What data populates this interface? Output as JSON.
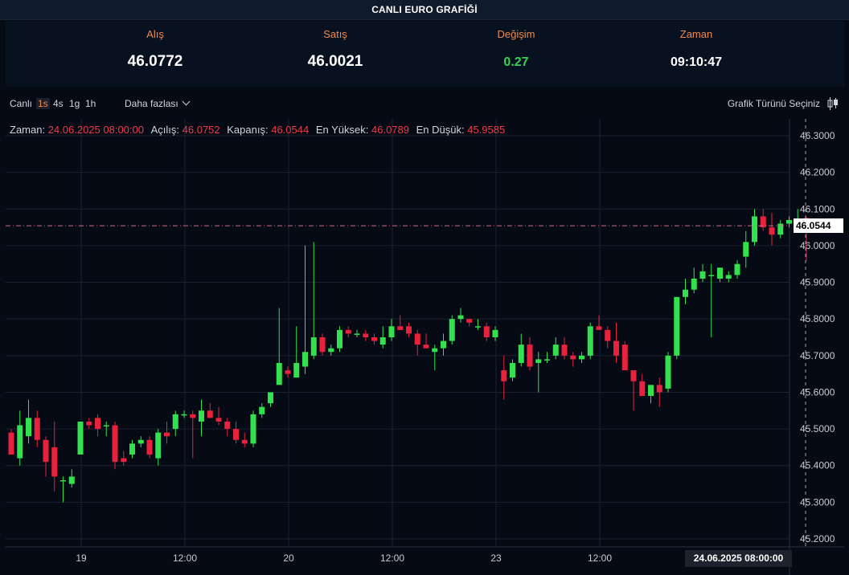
{
  "header": {
    "title": "CANLI EURO GRAFİĞİ"
  },
  "quote": {
    "buy_label": "Alış",
    "buy_value": "46.0772",
    "sell_label": "Satış",
    "sell_value": "46.0021",
    "change_label": "Değişim",
    "change_value": "0.27",
    "time_label": "Zaman",
    "time_value": "09:10:47"
  },
  "toolbar": {
    "live_label": "Canlı",
    "timeframes": [
      "1s",
      "4s",
      "1g",
      "1h"
    ],
    "active_timeframe": "1s",
    "more_label": "Daha fazlası",
    "chart_type_label": "Grafik Türünü Seçiniz"
  },
  "ohlc": {
    "time_label": "Zaman:",
    "time_value": "24.06.2025 08:00:00",
    "open_label": "Açılış:",
    "open_value": "46.0752",
    "close_label": "Kapanış:",
    "close_value": "46.0544",
    "high_label": "En Yüksek:",
    "high_value": "46.0789",
    "low_label": "En Düşük:",
    "low_value": "45.9585"
  },
  "crosshair": {
    "price_label": "46.0544",
    "time_label": "24.06.2025   08:00:00"
  },
  "colors": {
    "up": "#33e04d",
    "down": "#e8213d",
    "accent": "#f08a4b",
    "background": "#050a14"
  },
  "chart_data": {
    "type": "candlestick",
    "ylim": [
      45.18,
      46.33
    ],
    "yticks": [
      "46.3000",
      "46.2000",
      "46.1000",
      "46.0000",
      "45.9000",
      "45.8000",
      "45.7000",
      "45.6000",
      "45.5000",
      "45.4000",
      "45.3000",
      "45.2000"
    ],
    "xticks": [
      "19",
      "12:00",
      "20",
      "12:00",
      "23",
      "12:00"
    ],
    "xtick_index": [
      8,
      20,
      32,
      44,
      56,
      68
    ],
    "grid": true,
    "candles": [
      {
        "o": 45.49,
        "h": 45.5,
        "l": 45.45,
        "c": 45.43
      },
      {
        "o": 45.42,
        "h": 45.55,
        "l": 45.4,
        "c": 45.51
      },
      {
        "o": 45.48,
        "h": 45.58,
        "l": 45.46,
        "c": 45.53
      },
      {
        "o": 45.53,
        "h": 45.55,
        "l": 45.45,
        "c": 45.47
      },
      {
        "o": 45.47,
        "h": 45.48,
        "l": 45.37,
        "c": 45.41
      },
      {
        "o": 45.45,
        "h": 45.52,
        "l": 45.33,
        "c": 45.37
      },
      {
        "o": 45.36,
        "h": 45.37,
        "l": 45.3,
        "c": 45.36
      },
      {
        "o": 45.35,
        "h": 45.39,
        "l": 45.34,
        "c": 45.37
      },
      {
        "o": 45.43,
        "h": 45.52,
        "l": 45.43,
        "c": 45.52
      },
      {
        "o": 45.52,
        "h": 45.53,
        "l": 45.5,
        "c": 45.51
      },
      {
        "o": 45.53,
        "h": 45.54,
        "l": 45.48,
        "c": 45.5
      },
      {
        "o": 45.51,
        "h": 45.52,
        "l": 45.48,
        "c": 45.51
      },
      {
        "o": 45.51,
        "h": 45.52,
        "l": 45.39,
        "c": 45.41
      },
      {
        "o": 45.42,
        "h": 45.44,
        "l": 45.4,
        "c": 45.41
      },
      {
        "o": 45.43,
        "h": 45.47,
        "l": 45.42,
        "c": 45.46
      },
      {
        "o": 45.46,
        "h": 45.48,
        "l": 45.45,
        "c": 45.47
      },
      {
        "o": 45.47,
        "h": 45.48,
        "l": 45.42,
        "c": 45.43
      },
      {
        "o": 45.42,
        "h": 45.5,
        "l": 45.4,
        "c": 45.49
      },
      {
        "o": 45.49,
        "h": 45.52,
        "l": 45.46,
        "c": 45.48
      },
      {
        "o": 45.5,
        "h": 45.55,
        "l": 45.48,
        "c": 45.54
      },
      {
        "o": 45.54,
        "h": 45.55,
        "l": 45.53,
        "c": 45.54
      },
      {
        "o": 45.54,
        "h": 45.55,
        "l": 45.42,
        "c": 45.53
      },
      {
        "o": 45.52,
        "h": 45.58,
        "l": 45.48,
        "c": 45.55
      },
      {
        "o": 45.55,
        "h": 45.57,
        "l": 45.53,
        "c": 45.53
      },
      {
        "o": 45.53,
        "h": 45.56,
        "l": 45.51,
        "c": 45.52
      },
      {
        "o": 45.52,
        "h": 45.53,
        "l": 45.48,
        "c": 45.5
      },
      {
        "o": 45.5,
        "h": 45.52,
        "l": 45.46,
        "c": 45.47
      },
      {
        "o": 45.47,
        "h": 45.49,
        "l": 45.45,
        "c": 45.46
      },
      {
        "o": 45.46,
        "h": 45.55,
        "l": 45.45,
        "c": 45.54
      },
      {
        "o": 45.54,
        "h": 45.57,
        "l": 45.53,
        "c": 45.56
      },
      {
        "o": 45.57,
        "h": 45.6,
        "l": 45.56,
        "c": 45.6
      },
      {
        "o": 45.62,
        "h": 45.83,
        "l": 45.62,
        "c": 45.68
      },
      {
        "o": 45.66,
        "h": 45.67,
        "l": 45.64,
        "c": 45.65
      },
      {
        "o": 45.64,
        "h": 45.78,
        "l": 45.64,
        "c": 45.68
      },
      {
        "o": 45.67,
        "h": 46.0,
        "l": 45.65,
        "c": 45.71
      },
      {
        "o": 45.7,
        "h": 46.01,
        "l": 45.69,
        "c": 45.75
      },
      {
        "o": 45.75,
        "h": 45.76,
        "l": 45.7,
        "c": 45.71
      },
      {
        "o": 45.71,
        "h": 45.73,
        "l": 45.7,
        "c": 45.72
      },
      {
        "o": 45.72,
        "h": 45.78,
        "l": 45.71,
        "c": 45.77
      },
      {
        "o": 45.77,
        "h": 45.78,
        "l": 45.75,
        "c": 45.76
      },
      {
        "o": 45.76,
        "h": 45.77,
        "l": 45.75,
        "c": 45.76
      },
      {
        "o": 45.76,
        "h": 45.77,
        "l": 45.74,
        "c": 45.75
      },
      {
        "o": 45.75,
        "h": 45.76,
        "l": 45.73,
        "c": 45.74
      },
      {
        "o": 45.73,
        "h": 45.78,
        "l": 45.72,
        "c": 45.75
      },
      {
        "o": 45.75,
        "h": 45.8,
        "l": 45.74,
        "c": 45.78
      },
      {
        "o": 45.78,
        "h": 45.81,
        "l": 45.77,
        "c": 45.77
      },
      {
        "o": 45.78,
        "h": 45.79,
        "l": 45.75,
        "c": 45.76
      },
      {
        "o": 45.76,
        "h": 45.77,
        "l": 45.7,
        "c": 45.73
      },
      {
        "o": 45.73,
        "h": 45.76,
        "l": 45.72,
        "c": 45.72
      },
      {
        "o": 45.71,
        "h": 45.73,
        "l": 45.66,
        "c": 45.72
      },
      {
        "o": 45.72,
        "h": 45.76,
        "l": 45.7,
        "c": 45.74
      },
      {
        "o": 45.74,
        "h": 45.81,
        "l": 45.73,
        "c": 45.8
      },
      {
        "o": 45.8,
        "h": 45.83,
        "l": 45.79,
        "c": 45.81
      },
      {
        "o": 45.8,
        "h": 45.8,
        "l": 45.78,
        "c": 45.79
      },
      {
        "o": 45.78,
        "h": 45.8,
        "l": 45.77,
        "c": 45.78
      },
      {
        "o": 45.78,
        "h": 45.79,
        "l": 45.74,
        "c": 45.75
      },
      {
        "o": 45.75,
        "h": 45.78,
        "l": 45.74,
        "c": 45.77
      },
      {
        "o": 45.66,
        "h": 45.7,
        "l": 45.58,
        "c": 45.63
      },
      {
        "o": 45.64,
        "h": 45.69,
        "l": 45.63,
        "c": 45.68
      },
      {
        "o": 45.68,
        "h": 45.76,
        "l": 45.67,
        "c": 45.73
      },
      {
        "o": 45.73,
        "h": 45.75,
        "l": 45.66,
        "c": 45.67
      },
      {
        "o": 45.68,
        "h": 45.71,
        "l": 45.6,
        "c": 45.69
      },
      {
        "o": 45.69,
        "h": 45.71,
        "l": 45.68,
        "c": 45.69
      },
      {
        "o": 45.7,
        "h": 45.75,
        "l": 45.69,
        "c": 45.73
      },
      {
        "o": 45.73,
        "h": 45.75,
        "l": 45.69,
        "c": 45.7
      },
      {
        "o": 45.7,
        "h": 45.71,
        "l": 45.67,
        "c": 45.69
      },
      {
        "o": 45.69,
        "h": 45.71,
        "l": 45.68,
        "c": 45.7
      },
      {
        "o": 45.7,
        "h": 45.79,
        "l": 45.69,
        "c": 45.78
      },
      {
        "o": 45.78,
        "h": 45.81,
        "l": 45.77,
        "c": 45.77
      },
      {
        "o": 45.77,
        "h": 45.78,
        "l": 45.72,
        "c": 45.74
      },
      {
        "o": 45.74,
        "h": 45.79,
        "l": 45.68,
        "c": 45.7
      },
      {
        "o": 45.73,
        "h": 45.74,
        "l": 45.66,
        "c": 45.66
      },
      {
        "o": 45.66,
        "h": 45.66,
        "l": 45.55,
        "c": 45.63
      },
      {
        "o": 45.63,
        "h": 45.65,
        "l": 45.6,
        "c": 45.59
      },
      {
        "o": 45.59,
        "h": 45.62,
        "l": 45.57,
        "c": 45.62
      },
      {
        "o": 45.62,
        "h": 45.64,
        "l": 45.56,
        "c": 45.6
      },
      {
        "o": 45.61,
        "h": 45.71,
        "l": 45.6,
        "c": 45.7
      },
      {
        "o": 45.7,
        "h": 45.73,
        "l": 45.69,
        "c": 45.86
      },
      {
        "o": 45.86,
        "h": 45.91,
        "l": 45.84,
        "c": 45.88
      },
      {
        "o": 45.88,
        "h": 45.94,
        "l": 45.87,
        "c": 45.91
      },
      {
        "o": 45.91,
        "h": 45.95,
        "l": 45.9,
        "c": 45.93
      },
      {
        "o": 45.92,
        "h": 45.95,
        "l": 45.75,
        "c": 45.92
      },
      {
        "o": 45.91,
        "h": 45.94,
        "l": 45.9,
        "c": 45.94
      },
      {
        "o": 45.91,
        "h": 45.93,
        "l": 45.9,
        "c": 45.92
      },
      {
        "o": 45.92,
        "h": 45.96,
        "l": 45.91,
        "c": 45.95
      },
      {
        "o": 45.97,
        "h": 46.04,
        "l": 45.94,
        "c": 46.01
      },
      {
        "o": 46.01,
        "h": 46.1,
        "l": 46.0,
        "c": 46.08
      },
      {
        "o": 46.08,
        "h": 46.1,
        "l": 46.04,
        "c": 46.05
      },
      {
        "o": 46.05,
        "h": 46.09,
        "l": 46.0,
        "c": 46.03
      },
      {
        "o": 46.03,
        "h": 46.07,
        "l": 46.02,
        "c": 46.06
      },
      {
        "o": 46.06,
        "h": 46.08,
        "l": 46.05,
        "c": 46.07
      },
      {
        "o": 46.07,
        "h": 46.1,
        "l": 46.06,
        "c": 46.07
      },
      {
        "o": 46.0752,
        "h": 46.0789,
        "l": 45.9585,
        "c": 46.0544
      }
    ]
  }
}
